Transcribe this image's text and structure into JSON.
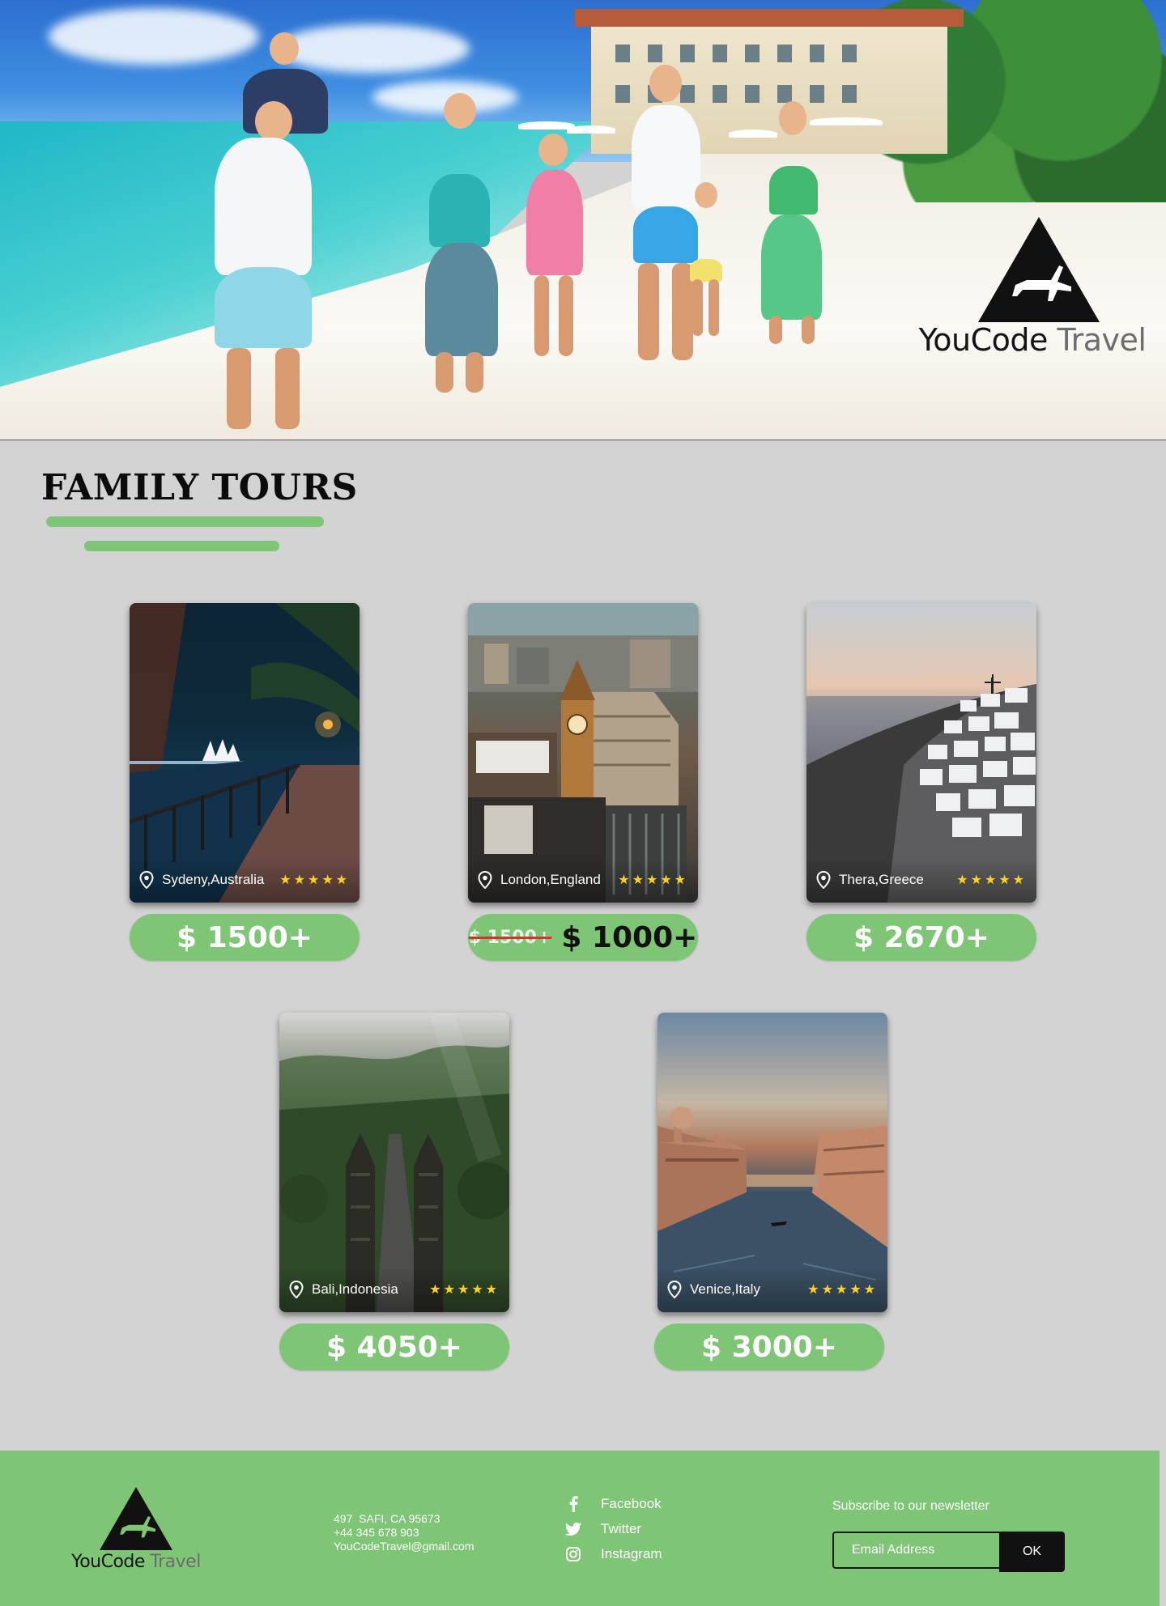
{
  "hero": {
    "brand_primary": "YouCode",
    "brand_secondary": "Travel"
  },
  "section": {
    "title": "FAMILY TOURS"
  },
  "tours": [
    {
      "location": "Sydeny,Australia",
      "rating": 5,
      "stars": "★★★★★",
      "price": "$ 1500+"
    },
    {
      "location": "London,England",
      "rating": 5,
      "stars": "★★★★★",
      "old_price": "$ 1500+",
      "price": "$ 1000+"
    },
    {
      "location": "Thera,Greece",
      "rating": 5,
      "stars": "★★★★★",
      "price": "$ 2670+"
    },
    {
      "location": "Bali,Indonesia",
      "rating": 5,
      "stars": "★★★★★",
      "price": "$ 4050+"
    },
    {
      "location": "Venice,Italy",
      "rating": 5,
      "stars": "★★★★★",
      "price": "$ 3000+"
    }
  ],
  "footer": {
    "brand_primary": "YouCode",
    "brand_secondary": "Travel",
    "contact": {
      "address": "497  SAFI, CA 95673",
      "phone": "+44 345 678 903",
      "email": "YouCodeTravel@gmail.com"
    },
    "social": [
      {
        "label": "Facebook",
        "icon": "facebook-icon"
      },
      {
        "label": "Twitter",
        "icon": "twitter-icon"
      },
      {
        "label": "Instagram",
        "icon": "instagram-icon"
      }
    ],
    "newsletter": {
      "label": "Subscribe to our newsletter",
      "placeholder": "Email Address",
      "button": "OK"
    }
  },
  "colors": {
    "accent_green": "#7ec575",
    "page_bg": "#d3d3d3",
    "star_yellow": "#ffd21a",
    "strike_red": "#d7312b"
  }
}
